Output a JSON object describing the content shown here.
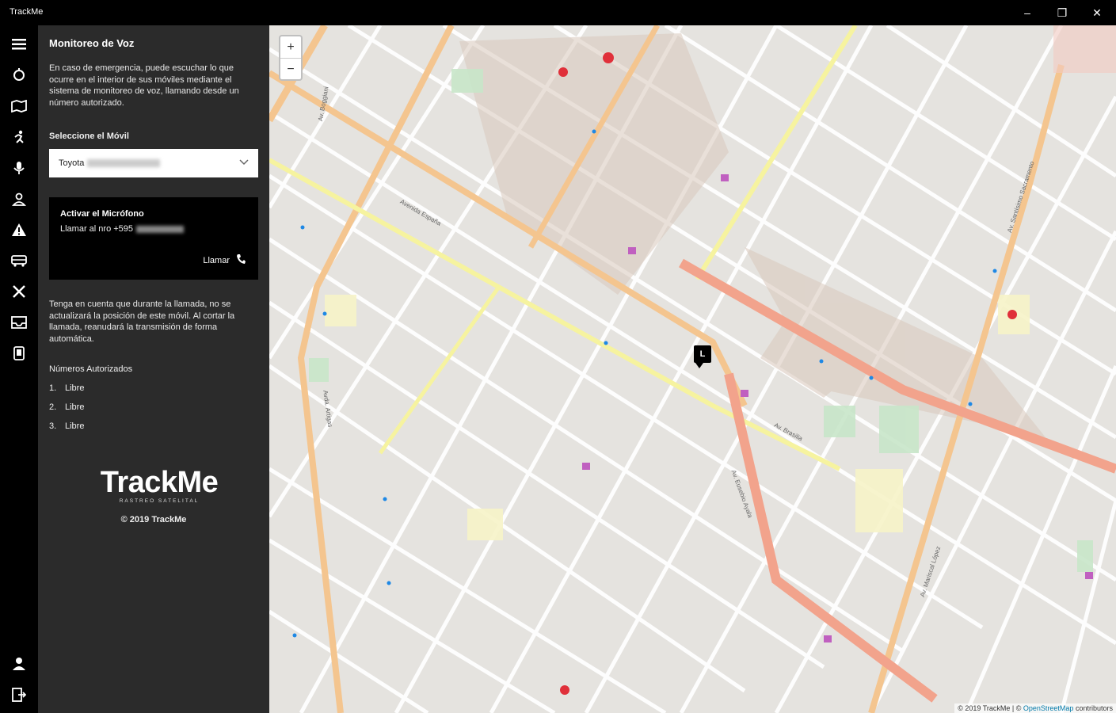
{
  "app": {
    "title": "TrackMe",
    "window_controls": [
      "–",
      "❐",
      "✕"
    ]
  },
  "rail": {
    "top_icons": [
      "menu-icon",
      "target-icon",
      "map-icon",
      "run-icon",
      "microphone-icon",
      "user-pin-icon",
      "warning-icon",
      "bus-icon",
      "tools-icon",
      "inbox-icon",
      "phone-device-icon"
    ],
    "bottom_icons": [
      "account-icon",
      "logout-icon"
    ]
  },
  "panel": {
    "heading": "Monitoreo de Voz",
    "description": "En caso de emergencia, puede escuchar lo que ocurre en el interior de sus móviles mediante el sistema de monitoreo de voz, llamando desde un número autorizado.",
    "select_label": "Seleccione el Móvil",
    "select_value": "Toyota",
    "card": {
      "title": "Activar el Micrófono",
      "subtitle": "Llamar al nro +595",
      "call_label": "Llamar"
    },
    "note": "Tenga en cuenta que durante la llamada, no se actualizará la posición de este móvil. Al cortar la llamada, reanudará la transmisión de forma automática.",
    "authorized_label": "Números Autorizados",
    "authorized": [
      {
        "n": "1.",
        "v": "Libre"
      },
      {
        "n": "2.",
        "v": "Libre"
      },
      {
        "n": "3.",
        "v": "Libre"
      }
    ],
    "logo_name": "TrackMe",
    "logo_sub": "RASTREO SATELITAL",
    "copyright": "© 2019 TrackMe"
  },
  "map": {
    "zoom_in": "+",
    "zoom_out": "−",
    "marker_label": "L",
    "attribution_prefix": "© 2019 TrackMe | ©",
    "attribution_link": "OpenStreetMap",
    "attribution_suffix": "contributors",
    "labels": [
      "Avenida España",
      "Avda. Artigas",
      "Av. Boggiani",
      "Av. Eusebio Ayala",
      "Av. Brasilia",
      "Av. Mariscal López",
      "Av. Santísimo Sacramento"
    ]
  }
}
